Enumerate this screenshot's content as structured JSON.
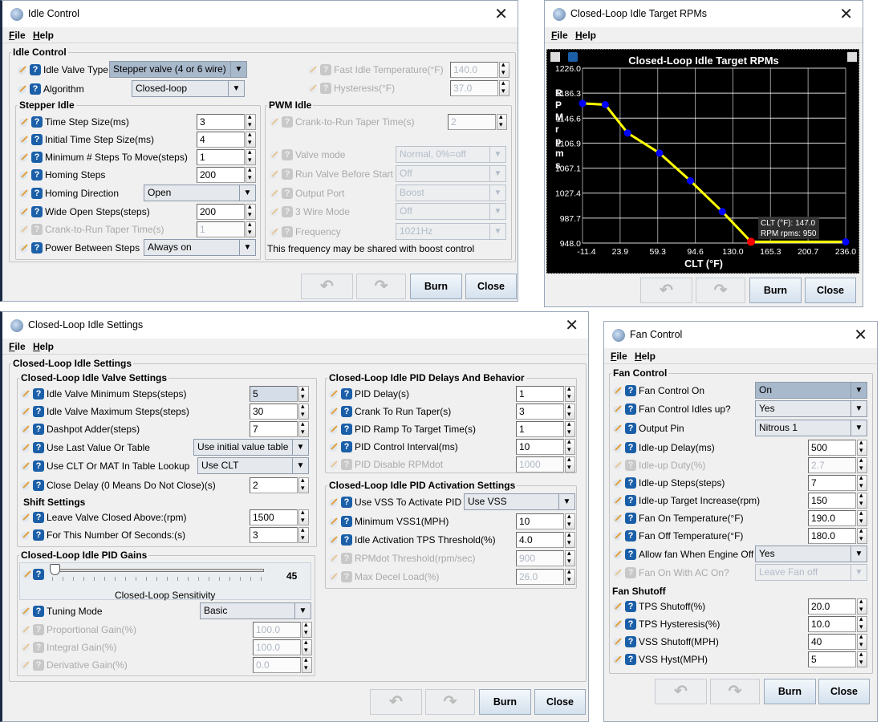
{
  "menu": [
    "File",
    "Help"
  ],
  "buttons": {
    "undo_icon": "undo-icon",
    "redo_icon": "redo-icon",
    "burn": "Burn",
    "close": "Close"
  },
  "idle": {
    "title": "Idle Control",
    "group_title": "Idle Control",
    "rows": [
      {
        "label": "Idle Valve Type",
        "value": "Stepper valve (4 or 6 wire)",
        "type": "combo",
        "highlight": true
      },
      {
        "label": "Algorithm",
        "value": "Closed-loop",
        "type": "combo"
      }
    ],
    "right_rows": [
      {
        "label": "Fast Idle Temperature(°F)",
        "value": "140.0",
        "type": "spin",
        "disabled": true
      },
      {
        "label": "Hysteresis(°F)",
        "value": "37.0",
        "type": "spin",
        "disabled": true
      }
    ],
    "stepper": {
      "title": "Stepper Idle",
      "rows": [
        {
          "label": "Time Step Size(ms)",
          "value": "3",
          "type": "spin"
        },
        {
          "label": "Initial Time Step Size(ms)",
          "value": "4",
          "type": "spin"
        },
        {
          "label": "Minimum # Steps To Move(steps)",
          "value": "1",
          "type": "spin"
        },
        {
          "label": "Homing Steps",
          "value": "200",
          "type": "spin"
        },
        {
          "label": "Homing Direction",
          "value": "Open",
          "type": "combo"
        },
        {
          "label": "Wide Open Steps(steps)",
          "value": "200",
          "type": "spin"
        },
        {
          "label": "Crank-to-Run Taper Time(s)",
          "value": "1",
          "type": "spin",
          "disabled": true
        },
        {
          "label": "Power Between Steps",
          "value": "Always on",
          "type": "combo"
        }
      ]
    },
    "pwm": {
      "title": "PWM Idle",
      "rows": [
        {
          "label": "Crank-to-Run Taper Time(s)",
          "value": "2",
          "type": "spin",
          "disabled": true
        },
        {
          "label": "Valve mode",
          "value": "Normal, 0%=off",
          "type": "combo",
          "disabled": true
        },
        {
          "label": "Run Valve Before Start",
          "value": "Off",
          "type": "combo",
          "disabled": true
        },
        {
          "label": "Output Port",
          "value": "Boost",
          "type": "combo",
          "disabled": true
        },
        {
          "label": "3 Wire Mode",
          "value": "Off",
          "type": "combo",
          "disabled": true
        },
        {
          "label": "Frequency",
          "value": "1021Hz",
          "type": "combo",
          "disabled": true
        }
      ],
      "note": "This frequency may be shared with boost control"
    }
  },
  "target": {
    "title": "Closed-Loop Idle Target RPMs",
    "tooltip": {
      "line1": "CLT (°F): 147.0",
      "line2": "RPM rpms: 950"
    }
  },
  "chart_data": {
    "type": "line",
    "title": "Closed-Loop Idle Target RPMs",
    "xlabel": "CLT (°F)",
    "ylabel": "RPM rpms",
    "xlim": [
      -11.4,
      236.0
    ],
    "ylim": [
      948.0,
      1226.0
    ],
    "x_ticks": [
      "-11.4",
      "23.9",
      "59.3",
      "94.6",
      "130.0",
      "165.3",
      "200.7",
      "236.0"
    ],
    "y_ticks": [
      "1226.0",
      "1186.3",
      "1146.6",
      "1106.9",
      "1067.1",
      "1027.4",
      "987.7",
      "948.0"
    ],
    "x": [
      -11.4,
      10,
      31,
      61,
      90,
      120,
      147,
      236
    ],
    "y": [
      1170,
      1168,
      1123,
      1091,
      1047,
      998,
      950,
      950
    ],
    "selected_index": 6,
    "grid": true,
    "colors": {
      "background": "#000000",
      "line": "#ffff00",
      "point": "#0000ff",
      "selected": "#ff0000",
      "grid": "#ffffff"
    }
  },
  "cl": {
    "title": "Closed-Loop Idle Settings",
    "group_title": "Closed-Loop Idle Settings",
    "valve": {
      "title": "Closed-Loop Idle Valve Settings",
      "rows": [
        {
          "label": "Idle Valve Minimum Steps(steps)",
          "value": "5",
          "type": "spin",
          "highlight": true
        },
        {
          "label": "Idle Valve Maximum Steps(steps)",
          "value": "30",
          "type": "spin"
        },
        {
          "label": "Dashpot Adder(steps)",
          "value": "7",
          "type": "spin"
        },
        {
          "label": "Use Last Value Or Table",
          "value": "Use initial value table",
          "type": "combo"
        },
        {
          "label": "Use CLT Or MAT In Table Lookup",
          "value": "Use CLT",
          "type": "combo"
        },
        {
          "label": "Close Delay (0 Means Do Not Close)(s)",
          "value": "2",
          "type": "spin"
        }
      ]
    },
    "shift": {
      "title": "Shift Settings",
      "rows": [
        {
          "label": "Leave Valve Closed Above:(rpm)",
          "value": "1500",
          "type": "spin"
        },
        {
          "label": "For This Number Of Seconds:(s)",
          "value": "3",
          "type": "spin"
        }
      ]
    },
    "gains": {
      "title": "Closed-Loop Idle PID Gains",
      "slider_value": "45",
      "slider_label": "Closed-Loop Sensitivity",
      "rows": [
        {
          "label": "Tuning Mode",
          "value": "Basic",
          "type": "combo"
        },
        {
          "label": "Proportional Gain(%)",
          "value": "100.0",
          "type": "spin",
          "disabled": true
        },
        {
          "label": "Integral Gain(%)",
          "value": "100.0",
          "type": "spin",
          "disabled": true
        },
        {
          "label": "Derivative Gain(%)",
          "value": "0.0",
          "type": "spin",
          "disabled": true
        }
      ]
    },
    "delays": {
      "title": "Closed-Loop Idle PID Delays And Behavior",
      "rows": [
        {
          "label": "PID Delay(s)",
          "value": "1",
          "type": "spin"
        },
        {
          "label": "Crank To Run Taper(s)",
          "value": "3",
          "type": "spin"
        },
        {
          "label": "PID Ramp To Target Time(s)",
          "value": "1",
          "type": "spin"
        },
        {
          "label": "PID Control Interval(ms)",
          "value": "10",
          "type": "spin"
        },
        {
          "label": "PID Disable RPMdot",
          "value": "1000",
          "type": "spin",
          "disabled": true
        }
      ]
    },
    "activation": {
      "title": "Closed-Loop Idle PID Activation Settings",
      "rows": [
        {
          "label": "Use VSS To Activate PID",
          "value": "Use VSS",
          "type": "combo"
        },
        {
          "label": "Minimum VSS1(MPH)",
          "value": "10",
          "type": "spin"
        },
        {
          "label": "Idle Activation TPS Threshold(%)",
          "value": "4.0",
          "type": "spin"
        },
        {
          "label": "RPMdot Threshold(rpm/sec)",
          "value": "900",
          "type": "spin",
          "disabled": true
        },
        {
          "label": "Max Decel Load(%)",
          "value": "26.0",
          "type": "spin",
          "disabled": true
        }
      ]
    }
  },
  "fan": {
    "title": "Fan Control",
    "group_title": "Fan Control",
    "rows": [
      {
        "label": "Fan Control On",
        "value": "On",
        "type": "combo",
        "highlight": true
      },
      {
        "label": "Fan Control Idles up?",
        "value": "Yes",
        "type": "combo"
      },
      {
        "label": "Output Pin",
        "value": "Nitrous 1",
        "type": "combo"
      },
      {
        "label": "Idle-up Delay(ms)",
        "value": "500",
        "type": "spin"
      },
      {
        "label": "Idle-up Duty(%)",
        "value": "2.7",
        "type": "spin",
        "disabled": true
      },
      {
        "label": "Idle-up Steps(steps)",
        "value": "7",
        "type": "spin"
      },
      {
        "label": "Idle-up Target Increase(rpm)",
        "value": "150",
        "type": "spin"
      },
      {
        "label": "Fan On Temperature(°F)",
        "value": "190.0",
        "type": "spin"
      },
      {
        "label": "Fan Off Temperature(°F)",
        "value": "180.0",
        "type": "spin"
      },
      {
        "label": "Allow fan When Engine Off",
        "value": "Yes",
        "type": "combo"
      },
      {
        "label": "Fan On With AC On?",
        "value": "Leave Fan off",
        "type": "combo",
        "disabled": true
      }
    ],
    "shutoff": {
      "title": "Fan Shutoff",
      "rows": [
        {
          "label": "TPS Shutoff(%)",
          "value": "20.0",
          "type": "spin"
        },
        {
          "label": "TPS Hysteresis(%)",
          "value": "10.0",
          "type": "spin"
        },
        {
          "label": "VSS Shutoff(MPH)",
          "value": "40",
          "type": "spin"
        },
        {
          "label": "VSS Hyst(MPH)",
          "value": "5",
          "type": "spin"
        }
      ]
    }
  }
}
